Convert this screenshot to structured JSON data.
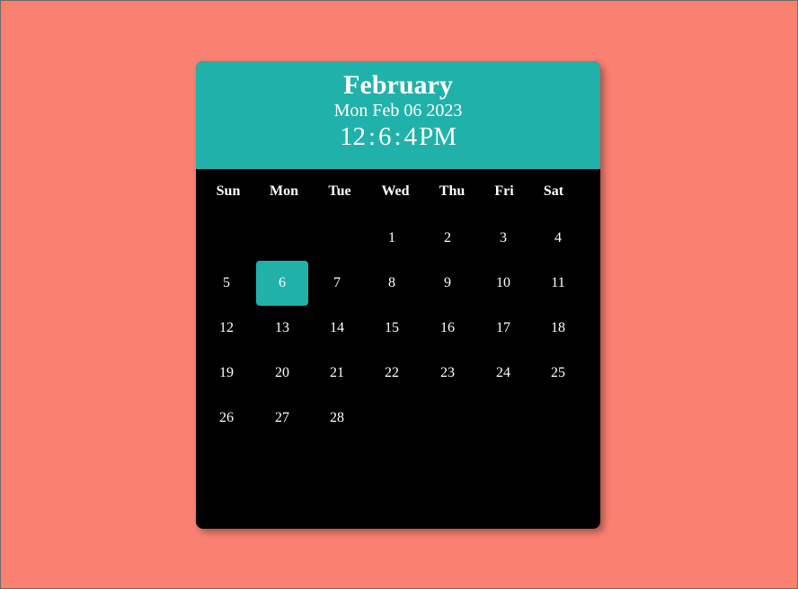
{
  "header": {
    "month": "February",
    "full_date": "Mon Feb 06 2023",
    "time": {
      "hours": "12",
      "minutes": "6",
      "seconds": "4",
      "ampm": "PM",
      "separator": ":"
    }
  },
  "weekdays": [
    "Sun",
    "Mon",
    "Tue",
    "Wed",
    "Thu",
    "Fri",
    "Sat"
  ],
  "weeks": [
    [
      "",
      "",
      "",
      "1",
      "2",
      "3",
      "4"
    ],
    [
      "5",
      "6",
      "7",
      "8",
      "9",
      "10",
      "11"
    ],
    [
      "12",
      "13",
      "14",
      "15",
      "16",
      "17",
      "18"
    ],
    [
      "19",
      "20",
      "21",
      "22",
      "23",
      "24",
      "25"
    ],
    [
      "26",
      "27",
      "28",
      "",
      "",
      "",
      ""
    ]
  ],
  "today": "6",
  "colors": {
    "background": "#FA8072",
    "accent": "#20B2AA",
    "calendar_body": "#000000",
    "text": "#FFFFFF"
  }
}
